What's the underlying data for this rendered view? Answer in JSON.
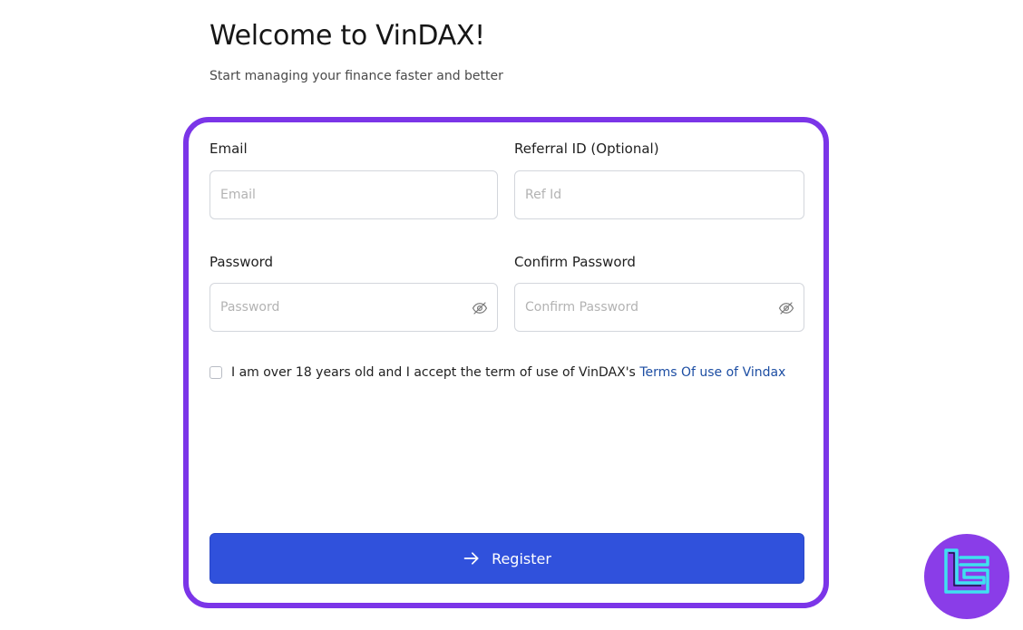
{
  "header": {
    "title": "Welcome to VinDAX!",
    "subtitle": "Start managing your finance faster and better"
  },
  "form": {
    "email": {
      "label": "Email",
      "placeholder": "Email",
      "value": ""
    },
    "referral": {
      "label": "Referral ID (Optional)",
      "placeholder": "Ref Id",
      "value": ""
    },
    "password": {
      "label": "Password",
      "placeholder": "Password",
      "value": ""
    },
    "confirm_password": {
      "label": "Confirm Password",
      "placeholder": "Confirm Password",
      "value": ""
    },
    "terms": {
      "checked": false,
      "text": "I am over 18 years old and I accept the term of use of VinDAX's ",
      "link_text": "Terms Of use of Vindax"
    },
    "register_label": "Register"
  },
  "icons": {
    "password_toggle": "eye-slash-icon",
    "register_arrow": "arrow-right-icon",
    "brand_badge": "brand-logo-icon"
  },
  "colors": {
    "frame_accent": "#7b35e8",
    "primary_button": "#3051dc",
    "link": "#1d4ea3",
    "badge_bg": "#8a3de8",
    "badge_mark": "#3fe0f0"
  }
}
